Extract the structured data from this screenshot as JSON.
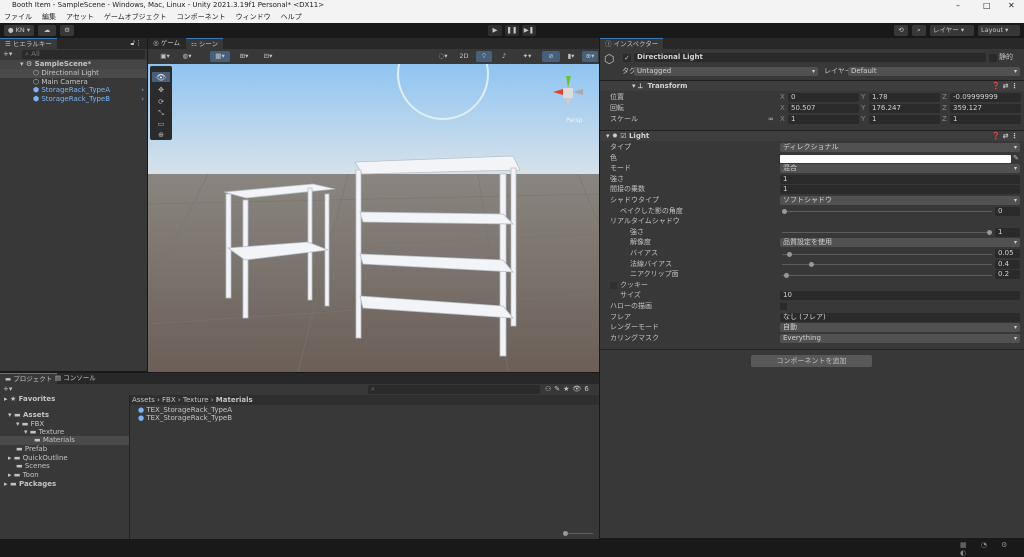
{
  "window": {
    "title": "Booth Item - SampleScene - Windows, Mac, Linux - Unity 2021.3.19f1 Personal* <DX11>",
    "minimize": "–",
    "maximize": "□",
    "close": "✕"
  },
  "menu": [
    "ファイル",
    "編集",
    "アセット",
    "ゲームオブジェクト",
    "コンポーネント",
    "ウィンドウ",
    "ヘルプ"
  ],
  "toolbar": {
    "account": "KN ▾",
    "layers": "レイヤー",
    "layout": "Layout"
  },
  "hierarchy": {
    "tab": "ヒエラルキー",
    "search_placeholder": "All",
    "scene": "SampleScene*",
    "items": [
      "Directional Light",
      "Main Camera",
      "StorageRack_TypeA",
      "StorageRack_TypeB"
    ]
  },
  "scene_view": {
    "tabs": [
      "ゲーム",
      "シーン"
    ],
    "mode_2d": "2D",
    "persp": "Persp"
  },
  "inspector": {
    "tab": "インスペクター",
    "object_name": "Directional Light",
    "static": "静的",
    "tag_label": "タグ",
    "tag": "Untagged",
    "layer_label": "レイヤー",
    "layer": "Default",
    "transform": {
      "title": "Transform",
      "rows": [
        {
          "label": "位置",
          "x": "0",
          "y": "1.78",
          "z": "-0.09999999"
        },
        {
          "label": "回転",
          "x": "50.507",
          "y": "176.247",
          "z": "359.127"
        },
        {
          "label": "スケール",
          "x": "1",
          "y": "1",
          "z": "1"
        }
      ]
    },
    "light": {
      "title": "Light",
      "type_label": "タイプ",
      "type": "ディレクショナル",
      "color_label": "色",
      "mode_label": "モード",
      "mode": "混合",
      "intensity_label": "強さ",
      "intensity": "1",
      "indirect_label": "間接の乗数",
      "indirect": "1",
      "shadow_type_label": "シャドウタイプ",
      "shadow_type": "ソフトシャドウ",
      "baked_angle_label": "ベイクした影の角度",
      "baked_angle": "0",
      "realtime_label": "リアルタイムシャドウ",
      "strength_label": "強さ",
      "strength": "1",
      "resolution_label": "解像度",
      "resolution": "品質設定を使用",
      "bias_label": "バイアス",
      "bias": "0.05",
      "normal_bias_label": "法線バイアス",
      "normal_bias": "0.4",
      "near_plane_label": "ニアクリップ面",
      "near_plane": "0.2",
      "cookie_label": "クッキー",
      "size_label": "サイズ",
      "size": "10",
      "halo_label": "ハローの描画",
      "flare_label": "フレア",
      "flare": "なし (フレア)",
      "render_mode_label": "レンダーモード",
      "render_mode": "自動",
      "culling_label": "カリングマスク",
      "culling": "Everything"
    },
    "add_component": "コンポーネントを追加"
  },
  "project": {
    "tabs": [
      "プロジェクト",
      "コンソール"
    ],
    "favorites": "Favorites",
    "tree": [
      "Assets",
      "FBX",
      "Texture",
      "Materials",
      "Prefab",
      "QuickOutline",
      "Scenes",
      "Toon",
      "Packages"
    ],
    "breadcrumb": [
      "Assets",
      "FBX",
      "Texture",
      "Materials"
    ],
    "files": [
      "TEX_StorageRack_TypeA",
      "TEX_StorageRack_TypeB"
    ],
    "hidden_count": "6"
  },
  "sliders": {
    "baked_angle": 0,
    "strength": 1,
    "bias": 0.05,
    "normal_bias": 0.4,
    "near_plane": 0.2
  }
}
